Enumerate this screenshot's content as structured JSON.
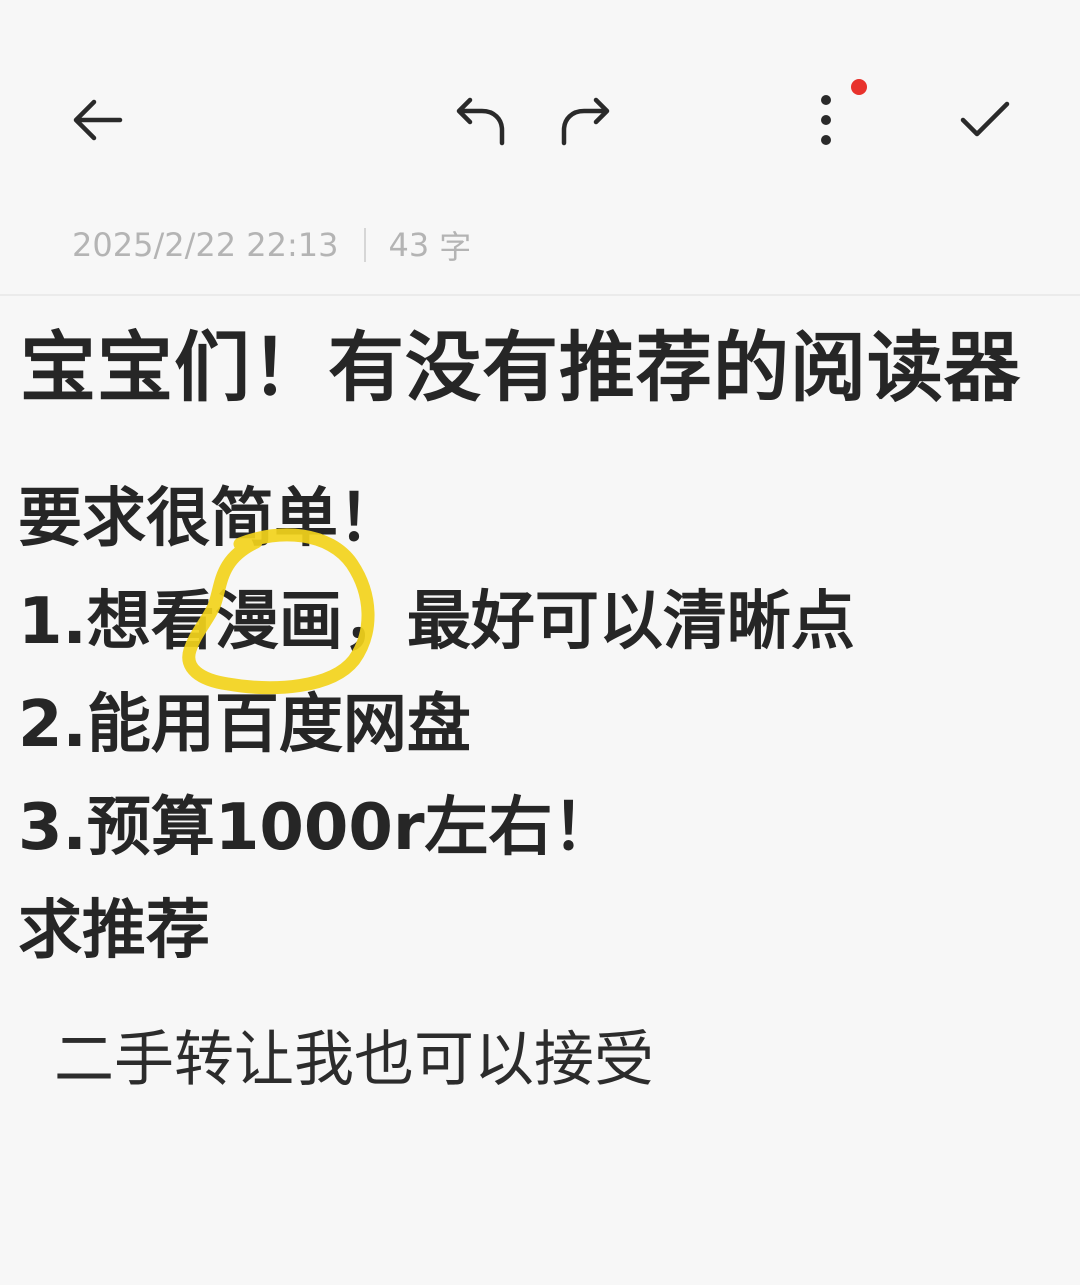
{
  "toolbar": {
    "back_icon": "arrow-left-icon",
    "undo_icon": "undo-icon",
    "redo_icon": "redo-icon",
    "more_icon": "more-vertical-icon",
    "done_icon": "check-icon",
    "notification_dot_color": "#e8322c"
  },
  "meta": {
    "datetime": "2025/2/22 22:13",
    "separator": "|",
    "char_count": "43",
    "char_unit": "字"
  },
  "note": {
    "title": "宝宝们！有没有推荐的阅读器",
    "body_lines": [
      "要求很简单！",
      "1.想看漫画，最好可以清晰点",
      "2.能用百度网盘",
      "3.预算1000r左右！",
      "求推荐"
    ],
    "extra_line": "二手转让我也可以接受"
  },
  "annotation": {
    "highlight_color": "#f2d21b"
  }
}
